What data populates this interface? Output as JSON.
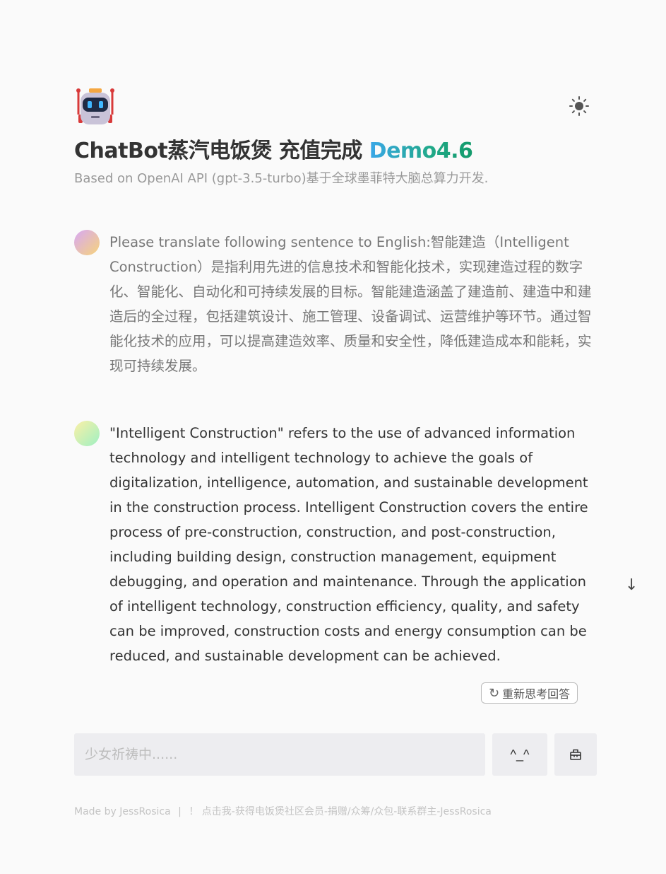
{
  "header": {
    "title": "ChatBot蒸汽电饭煲 充值完成 ",
    "version": "Demo4.6",
    "subtitle": "Based on OpenAI API (gpt-3.5-turbo)基于全球墨菲特大脑总算力开发.",
    "logo_icon": "robot-icon",
    "theme_icon": "sun-icon"
  },
  "messages": [
    {
      "role": "user",
      "text": "Please translate following sentence to English:智能建造（Intelligent Construction）是指利用先进的信息技术和智能化技术，实现建造过程的数字化、智能化、自动化和可持续发展的目标。智能建造涵盖了建造前、建造中和建造后的全过程，包括建筑设计、施工管理、设备调试、运营维护等环节。通过智能化技术的应用，可以提高建造效率、质量和安全性，降低建造成本和能耗，实现可持续发展。"
    },
    {
      "role": "assistant",
      "text": "\"Intelligent Construction\" refers to the use of advanced information technology and intelligent technology to achieve the goals of digitalization, intelligence, automation, and sustainable development in the construction process. Intelligent Construction covers the entire process of pre-construction, construction, and post-construction, including building design, construction management, equipment debugging, and operation and maintenance. Through the application of intelligent technology, construction efficiency, quality, and safety can be improved, construction costs and energy consumption can be reduced, and sustainable development can be achieved."
    }
  ],
  "controls": {
    "scroll_down_icon": "↓",
    "regenerate_icon": "↻",
    "regenerate_label": "重新思考回答",
    "input_placeholder": "少女祈祷中......",
    "send_label": "^_^",
    "clear_icon": "basket-icon"
  },
  "footer": {
    "made_by": "Made by  JessRosica",
    "separator": "|",
    "link": "！ 点击我-获得电饭煲社区会员-捐赠/众筹/众包-联系群主-JessRosica"
  }
}
